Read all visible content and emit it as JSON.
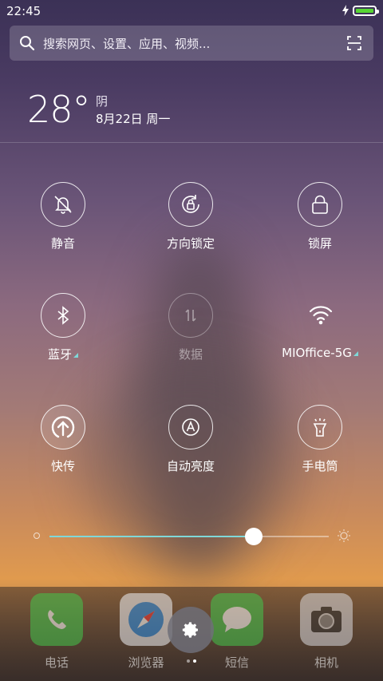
{
  "status": {
    "time": "22:45"
  },
  "search": {
    "placeholder": "搜索网页、设置、应用、视频..."
  },
  "weather": {
    "temperature": "28°",
    "condition": "阴",
    "date": "8月22日 周一"
  },
  "toggles": [
    {
      "label": "静音",
      "icon": "mute-bell-icon",
      "state": "off"
    },
    {
      "label": "方向锁定",
      "icon": "rotation-lock-icon",
      "state": "off"
    },
    {
      "label": "锁屏",
      "icon": "lock-icon",
      "state": "off"
    },
    {
      "label": "蓝牙",
      "icon": "bluetooth-icon",
      "state": "off",
      "has_more": true
    },
    {
      "label": "数据",
      "icon": "mobile-data-icon",
      "state": "disabled"
    },
    {
      "label": "MIOffice-5G",
      "icon": "wifi-icon",
      "state": "on",
      "has_more": true
    },
    {
      "label": "快传",
      "icon": "quick-transfer-icon",
      "state": "on"
    },
    {
      "label": "自动亮度",
      "icon": "auto-brightness-icon",
      "state": "off"
    },
    {
      "label": "手电筒",
      "icon": "flashlight-icon",
      "state": "off"
    }
  ],
  "brightness": {
    "level": 0.73
  },
  "dock": {
    "apps": [
      {
        "label": "电话",
        "icon": "phone-icon"
      },
      {
        "label": "浏览器",
        "icon": "browser-compass-icon"
      },
      {
        "label": "短信",
        "icon": "messages-icon"
      },
      {
        "label": "相机",
        "icon": "camera-icon"
      }
    ]
  },
  "colors": {
    "accent": "#7fd8d8",
    "battery": "#58d634"
  }
}
